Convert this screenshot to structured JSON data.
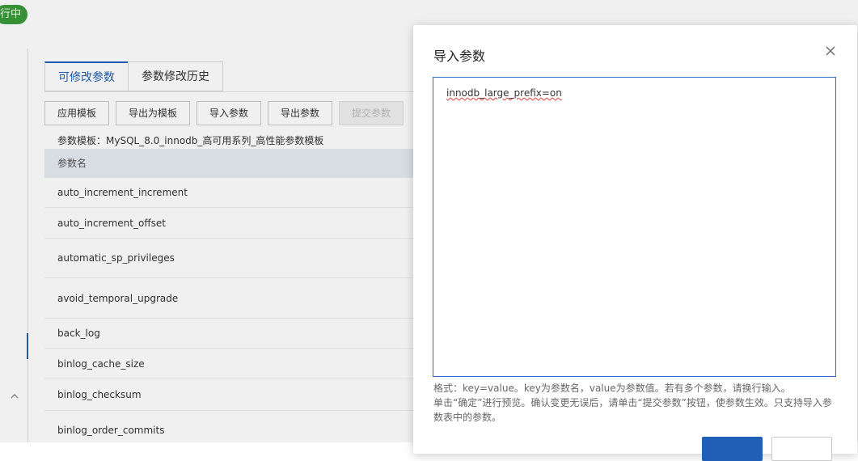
{
  "status_badge": "行中",
  "tabs": [
    {
      "label": "可修改参数",
      "active": true
    },
    {
      "label": "参数修改历史",
      "active": false
    }
  ],
  "toolbar": [
    {
      "label": "应用模板",
      "disabled": false
    },
    {
      "label": "导出为模板",
      "disabled": false
    },
    {
      "label": "导入参数",
      "disabled": false
    },
    {
      "label": "导出参数",
      "disabled": false
    },
    {
      "label": "提交参数",
      "disabled": true
    }
  ],
  "template_line": "参数模板：MySQL_8.0_innodb_高可用系列_高性能参数模板",
  "table": {
    "header": "参数名",
    "rows": [
      "auto_increment_increment",
      "auto_increment_offset",
      "automatic_sp_privileges",
      "avoid_temporal_upgrade",
      "back_log",
      "binlog_cache_size",
      "binlog_checksum",
      "binlog_order_commits"
    ]
  },
  "dialog": {
    "title": "导入参数",
    "textarea_value": "innodb_large_prefix=on",
    "hint_line1": "格式：key=value。key为参数名，value为参数值。若有多个参数，请换行输入。",
    "hint_line2": "单击“确定”进行预览。确认变更无误后，请单击“提交参数”按钮，使参数生效。只支持导入参数表中的参数。"
  },
  "colors": {
    "accent": "#1f5fb8",
    "status_green": "#3a9a3a",
    "table_header_bg": "#e6ebf2"
  },
  "icons": [
    "close-icon",
    "chevron-up-icon"
  ]
}
